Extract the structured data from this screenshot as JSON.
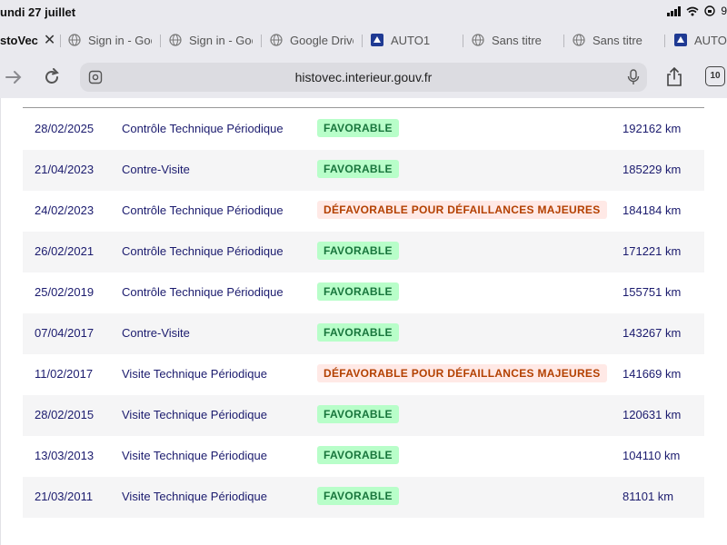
{
  "status_bar": {
    "time_date": "undi 27 juillet",
    "battery": "9"
  },
  "tabs": [
    {
      "label": "stoVec",
      "active": true
    },
    {
      "label": "Sign in - Goo"
    },
    {
      "label": "Sign in - Goo"
    },
    {
      "label": "Google Drive"
    },
    {
      "label": "AUTO1"
    },
    {
      "label": "Sans titre"
    },
    {
      "label": "Sans titre"
    },
    {
      "label": "AUTO"
    }
  ],
  "toolbar": {
    "url": "histovec.interieur.gouv.fr",
    "tab_count": "10"
  },
  "records": [
    {
      "date": "28/02/2025",
      "type": "Contrôle Technique Périodique",
      "result": "FAVORABLE",
      "status": "ok",
      "km": "192162 km"
    },
    {
      "date": "21/04/2023",
      "type": "Contre-Visite",
      "result": "FAVORABLE",
      "status": "ok",
      "km": "185229 km"
    },
    {
      "date": "24/02/2023",
      "type": "Contrôle Technique Périodique",
      "result": "DÉFAVORABLE POUR DÉFAILLANCES MAJEURES",
      "status": "ko",
      "km": "184184 km"
    },
    {
      "date": "26/02/2021",
      "type": "Contrôle Technique Périodique",
      "result": "FAVORABLE",
      "status": "ok",
      "km": "171221 km"
    },
    {
      "date": "25/02/2019",
      "type": "Contrôle Technique Périodique",
      "result": "FAVORABLE",
      "status": "ok",
      "km": "155751 km"
    },
    {
      "date": "07/04/2017",
      "type": "Contre-Visite",
      "result": "FAVORABLE",
      "status": "ok",
      "km": "143267 km"
    },
    {
      "date": "11/02/2017",
      "type": "Visite Technique Périodique",
      "result": "DÉFAVORABLE POUR DÉFAILLANCES MAJEURES",
      "status": "ko",
      "km": "141669 km"
    },
    {
      "date": "28/02/2015",
      "type": "Visite Technique Périodique",
      "result": "FAVORABLE",
      "status": "ok",
      "km": "120631 km"
    },
    {
      "date": "13/03/2013",
      "type": "Visite Technique Périodique",
      "result": "FAVORABLE",
      "status": "ok",
      "km": "104110 km"
    },
    {
      "date": "21/03/2011",
      "type": "Visite Technique Périodique",
      "result": "FAVORABLE",
      "status": "ok",
      "km": "81101 km"
    }
  ],
  "colors": {
    "ok_bg": "#b8fec9",
    "ok_text": "#18753c",
    "ko_bg": "#ffe9e6",
    "ko_text": "#b34000",
    "link_text": "#1b1b6e"
  },
  "icons": {
    "back": "arrow-left-icon",
    "forward": "arrow-right-icon",
    "reload": "reload-icon",
    "reader": "page-settings-icon",
    "mic": "microphone-icon",
    "share": "share-icon"
  }
}
